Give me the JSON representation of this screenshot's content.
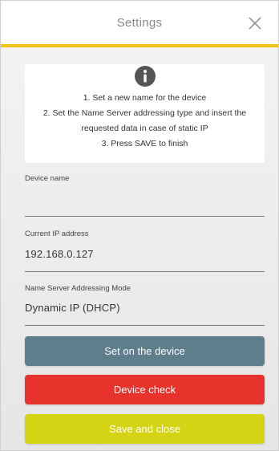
{
  "header": {
    "title": "Settings",
    "accent_color": "#f2c21b",
    "close_icon": "close-icon"
  },
  "info": {
    "icon": "info-icon",
    "lines": [
      "1. Set a new name for the device",
      "2. Set the Name Server addressing type and insert the",
      "requested data in case of static IP",
      "3. Press SAVE to finish"
    ]
  },
  "fields": {
    "device_name": {
      "label": "Device name",
      "value": ""
    },
    "current_ip": {
      "label": "Current IP address",
      "value": "192.168.0.127"
    },
    "ns_mode": {
      "label": "Name Server Addressing Mode",
      "value": "Dynamic IP (DHCP)"
    }
  },
  "buttons": {
    "set_device": {
      "label": "Set on the device",
      "color": "#5f7e8c"
    },
    "device_check": {
      "label": "Device check",
      "color": "#e8332c"
    },
    "save_close": {
      "label": "Save and close",
      "color": "#d4d414"
    }
  }
}
